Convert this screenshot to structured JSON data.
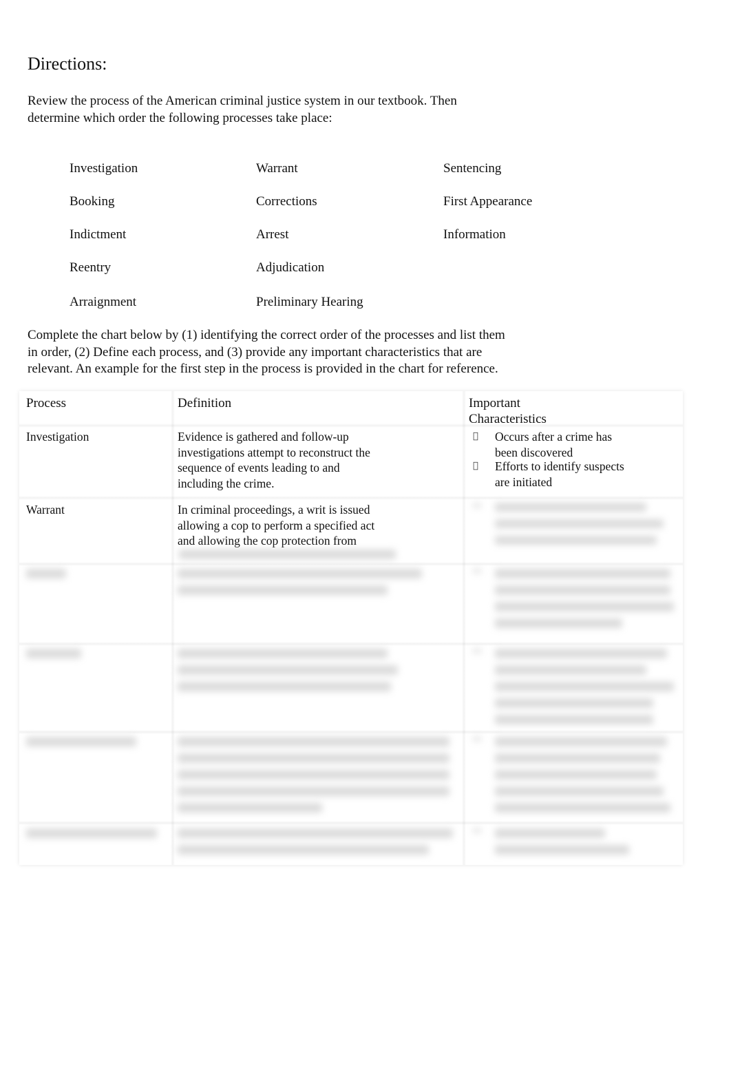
{
  "heading": "Directions:",
  "intro": {
    "line1": "Review the process of the American criminal justice system in our textbook. Then",
    "line2": "determine which order the following processes take place:"
  },
  "terms": {
    "col1": [
      "Investigation",
      "Booking",
      "Indictment",
      "Reentry",
      "Arraignment"
    ],
    "col2": [
      "Warrant",
      "Corrections",
      "Arrest",
      "Adjudication",
      "Preliminary Hearing"
    ],
    "col3": [
      "Sentencing",
      "First Appearance",
      "Information"
    ]
  },
  "instructions": {
    "line1": "Complete the chart below by (1) identifying the correct order of the processes and list them",
    "line2": "in order, (2) Define each process, and (3) provide any important characteristics that are",
    "line3": "relevant. An example for the first step in the process is provided in the chart for reference."
  },
  "table": {
    "headers": {
      "process": "Process",
      "definition": "Definition",
      "characteristics_line1": "Important",
      "characteristics_line2": "Characteristics"
    },
    "rows": [
      {
        "process": "Investigation",
        "definition_lines": [
          "Evidence is gathered and follow-up",
          "investigations attempt to reconstruct the",
          "sequence of events leading to and",
          "including the crime."
        ],
        "characteristics": [
          {
            "lines": [
              "Occurs after a crime has",
              "been discovered"
            ]
          },
          {
            "lines": [
              "Efforts to identify suspects",
              "are initiated"
            ]
          }
        ]
      },
      {
        "process": "Warrant",
        "definition_lines": [
          "In criminal proceedings, a writ is issued",
          "allowing a cop to perform a specified act",
          "and allowing the cop protection from"
        ]
      }
    ],
    "bullet_glyph": ""
  }
}
